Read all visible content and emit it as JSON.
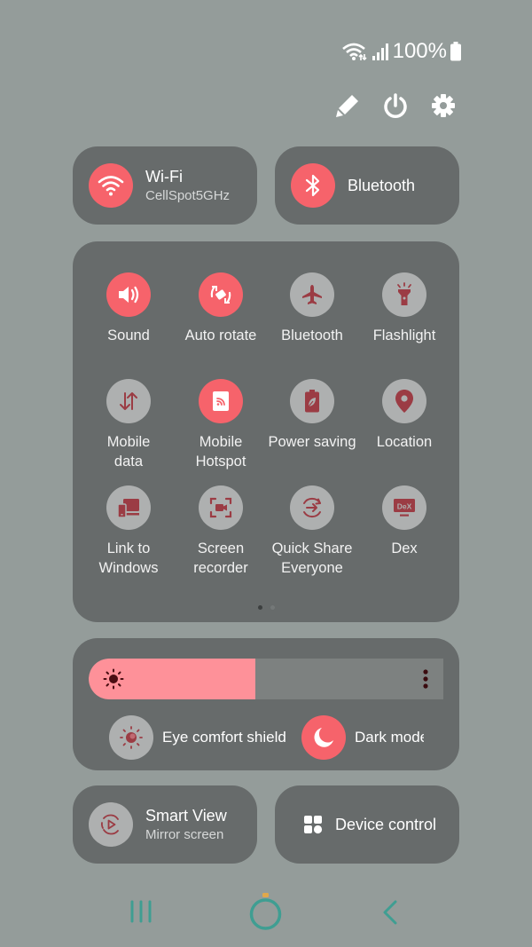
{
  "status_bar": {
    "icons": [
      "wifi-data-icon",
      "signal-icon",
      "battery-icon"
    ],
    "battery": "100%"
  },
  "top_actions": [
    {
      "name": "edit",
      "icon": "pencil-icon"
    },
    {
      "name": "power",
      "icon": "power-icon"
    },
    {
      "name": "settings",
      "icon": "gear-icon"
    }
  ],
  "wifi": {
    "title": "Wi-Fi",
    "subtitle": "CellSpot5GHz",
    "state": "on",
    "icon": "wifi-icon"
  },
  "bluetooth_pill": {
    "title": "Bluetooth",
    "state": "on",
    "icon": "bluetooth-icon"
  },
  "tiles": [
    {
      "label": "Sound",
      "state": "on",
      "icon": "sound-icon"
    },
    {
      "label": "Auto rotate",
      "state": "on",
      "icon": "auto-rotate-icon"
    },
    {
      "label": "Bluetooth",
      "state": "off",
      "icon": "airplane-icon"
    },
    {
      "label": "Flashlight",
      "state": "off",
      "icon": "flashlight-icon"
    },
    {
      "label": "Mobile\ndata",
      "state": "off",
      "icon": "mobile-data-icon"
    },
    {
      "label": "Mobile\nHotspot",
      "state": "on",
      "icon": "hotspot-icon"
    },
    {
      "label": "Power saving",
      "state": "off",
      "icon": "power-saving-icon"
    },
    {
      "label": "Location",
      "state": "off",
      "icon": "location-icon"
    },
    {
      "label": "Link to\nWindows",
      "state": "off",
      "icon": "link-to-windows-icon"
    },
    {
      "label": "Screen\nrecorder",
      "state": "off",
      "icon": "screen-recorder-icon"
    },
    {
      "label": "Quick Share\nEveryone",
      "state": "off",
      "icon": "quick-share-icon"
    },
    {
      "label": "Dex",
      "state": "off",
      "icon": "dex-icon"
    }
  ],
  "pagination": {
    "current": 1,
    "total": 2
  },
  "brightness": {
    "level_percent": 47
  },
  "eye_comfort": {
    "label": "Eye comfort shield",
    "state": "off"
  },
  "dark_mode": {
    "label": "Dark mode",
    "state": "on"
  },
  "smart_view": {
    "title": "Smart View",
    "subtitle": "Mirror screen",
    "state": "off"
  },
  "device_control": {
    "title": "Device control"
  },
  "nav": {
    "recents": "recents-icon",
    "home": "home-icon",
    "back": "back-icon"
  },
  "colors": {
    "background": "#949c9a",
    "card": "#676b6b",
    "accent_on": "#f6636b",
    "icon_off_bg": "#aeb0b0",
    "icon_off_glyph": "#9b3c44",
    "brightness_fill": "#fe9199",
    "nav_color": "#3f9e92"
  }
}
